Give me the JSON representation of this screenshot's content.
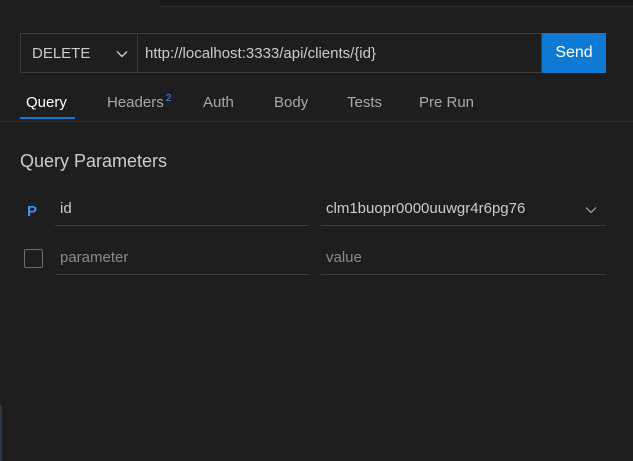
{
  "request": {
    "method": "DELETE",
    "url": "http://localhost:3333/api/clients/{id}",
    "send_label": "Send"
  },
  "tabs": [
    {
      "label": "Query",
      "active": true
    },
    {
      "label": "Headers",
      "badge": "2"
    },
    {
      "label": "Auth"
    },
    {
      "label": "Body"
    },
    {
      "label": "Tests"
    },
    {
      "label": "Pre Run"
    }
  ],
  "query": {
    "title": "Query Parameters",
    "params": [
      {
        "badge": "P",
        "name": "id",
        "value": "clm1buopr0000uuwgr4r6pg76"
      }
    ],
    "new_row": {
      "name_placeholder": "parameter",
      "value_placeholder": "value"
    }
  },
  "colors": {
    "accent": "#0e7ad3",
    "badge": "#3794ff",
    "background": "#1e1e1e"
  },
  "icons": {
    "method_dropdown": "chevron-down-icon",
    "value_dropdown": "chevron-down-icon"
  }
}
